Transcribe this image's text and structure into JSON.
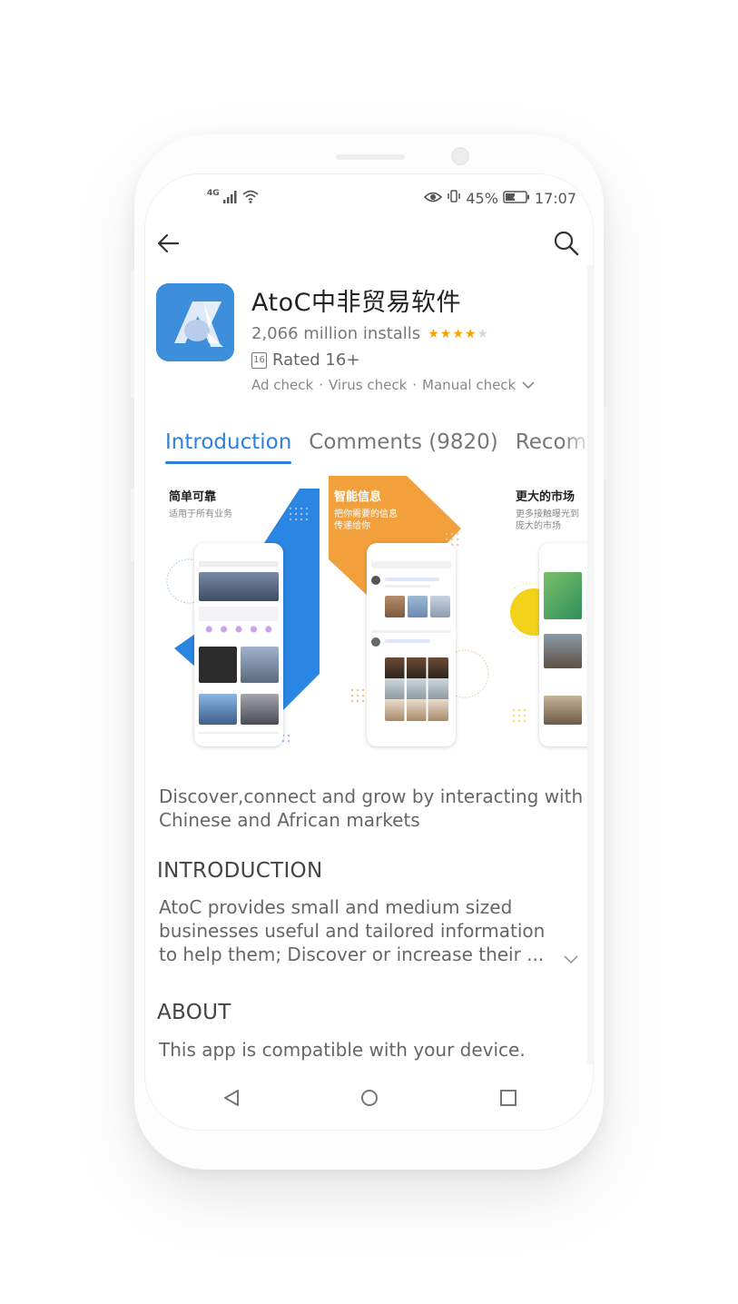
{
  "status_bar": {
    "network": "4G",
    "battery_percent": "45%",
    "time": "17:07"
  },
  "app": {
    "title": "AtoC中非贸易软件",
    "installs": "2,066 million installs",
    "rating_stars": 4,
    "rating_max": 5,
    "age_rating_badge": "16",
    "age_rating": "Rated 16+",
    "checks": [
      "Ad check",
      "Virus check",
      "Manual check"
    ],
    "check_separator": "·"
  },
  "tabs": [
    {
      "label": "Introduction",
      "active": true
    },
    {
      "label": "Comments (9820)",
      "active": false
    },
    {
      "label": "Recomme",
      "active": false
    }
  ],
  "screenshots": [
    {
      "heading": "简单可靠",
      "subtitle": "适用于所有业务",
      "accent": "#2b86e3"
    },
    {
      "heading": "智能信息",
      "subtitle": "把你需要的信息\n传递给你",
      "accent": "#f2a03c"
    },
    {
      "heading": "更大的市场",
      "subtitle": "更多接触曝光到\n庞大的市场",
      "accent": "#f3d21c"
    }
  ],
  "description": "Discover,connect and grow by interacting with Chinese and African markets",
  "introduction": {
    "heading": "INTRODUCTION",
    "text": "AtoC provides small and medium sized businesses useful and tailored information to help them; Discover or increase their ..."
  },
  "about": {
    "heading": "ABOUT",
    "text": "This app is compatible with your device."
  },
  "colors": {
    "accent": "#2f7fdc",
    "star": "#f5a300",
    "app_icon_bg": "#3d8fdc"
  },
  "icons": [
    "back-arrow-icon",
    "search-icon",
    "chevron-down-icon",
    "nav-back-icon",
    "nav-home-icon",
    "nav-recents-icon"
  ]
}
